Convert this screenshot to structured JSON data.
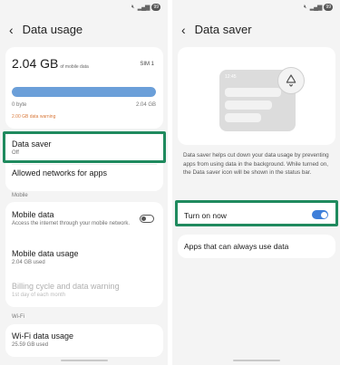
{
  "left": {
    "status": {
      "battery": "99"
    },
    "header": {
      "back_icon": "chevron-left-icon",
      "title": "Data usage"
    },
    "usage": {
      "amount": "2.04 GB",
      "unit": "of mobile data",
      "sim": "SIM 1",
      "bar_fraction": 1.0,
      "bar_min": "0 byte",
      "bar_max": "2.04 GB",
      "warning": "2.00 GB data warning",
      "warning_color": "#d97a3c",
      "bar_color": "#6b9fd9"
    },
    "data_saver": {
      "title": "Data saver",
      "status": "Off"
    },
    "allowed": {
      "title": "Allowed networks for apps"
    },
    "mobile_section": "Mobile",
    "mobile_data": {
      "title": "Mobile data",
      "desc": "Access the internet through your mobile network.",
      "toggle": "off"
    },
    "mobile_usage": {
      "title": "Mobile data usage",
      "value": "2.04 GB used"
    },
    "billing": {
      "title": "Billing cycle and data warning",
      "value": "1st day of each month"
    },
    "wifi_section": "Wi-Fi",
    "wifi_usage": {
      "title": "Wi-Fi data usage",
      "value": "25.59 GB used"
    }
  },
  "right": {
    "status": {
      "battery": "99"
    },
    "header": {
      "back_icon": "chevron-left-icon",
      "title": "Data saver"
    },
    "illustration": {
      "time": "12:45",
      "icon": "data-saver-icon"
    },
    "description": "Data saver helps cut down your data usage by preventing apps from using data in the background. While turned on, the Data saver icon will be shown in the status bar.",
    "turn_on": {
      "label": "Turn on now",
      "toggle": "on",
      "accent": "#3e7fd9"
    },
    "apps": {
      "label": "Apps that can always use data"
    }
  },
  "highlight_color": "#1f8a5e"
}
